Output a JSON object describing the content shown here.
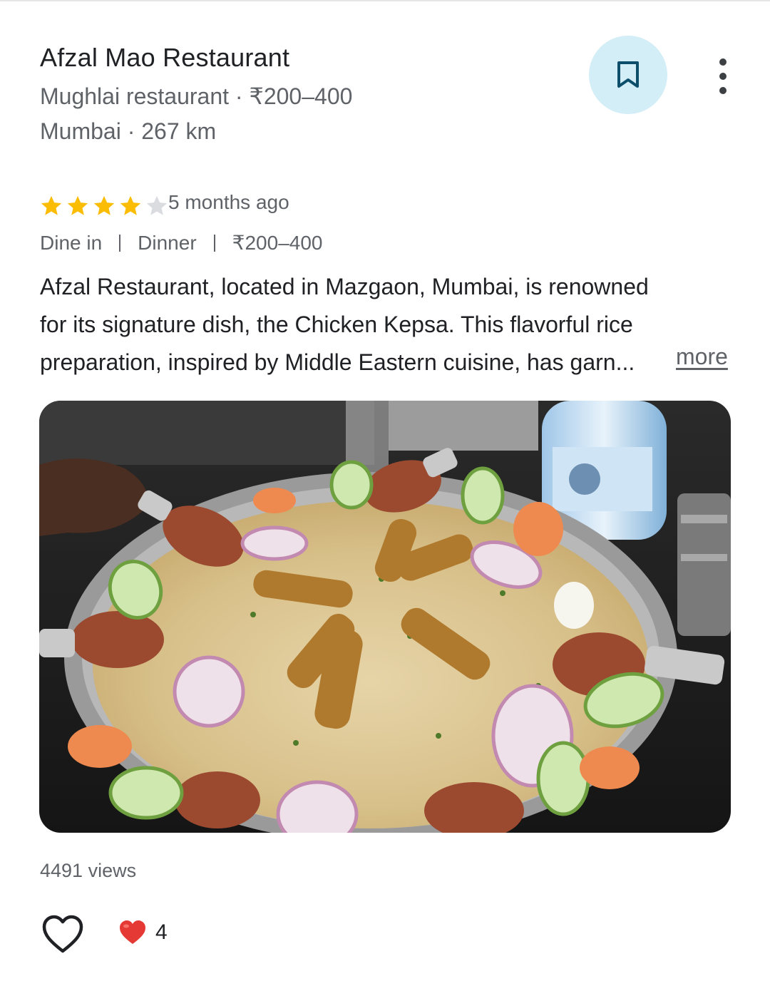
{
  "place": {
    "name": "Afzal Mao Restaurant",
    "category_price": "Mughlai restaurant · ₹200–400",
    "location_distance": "Mumbai · 267 km"
  },
  "actions": {
    "save_icon": "bookmark-icon",
    "menu_icon": "more-vert-icon"
  },
  "review": {
    "rating": 4,
    "rating_max": 5,
    "time": "5 months ago",
    "tags": [
      "Dine in",
      "Dinner",
      "₹200–400"
    ],
    "text_lines": [
      "Afzal Restaurant, located in Mazgaon, Mumbai, is renowned",
      "for its signature dish, the Chicken Kepsa. This flavorful rice",
      "preparation, inspired by Middle Eastern cuisine, has garn..."
    ],
    "more_label": "more"
  },
  "photo": {
    "subject": "photo-food-platter"
  },
  "stats": {
    "views": "4491 views",
    "reaction_count": "4"
  },
  "colors": {
    "star_filled": "#fbbc04",
    "star_empty": "#dadce0",
    "save_bg": "#d3eef7",
    "heart_red": "#e53935"
  }
}
